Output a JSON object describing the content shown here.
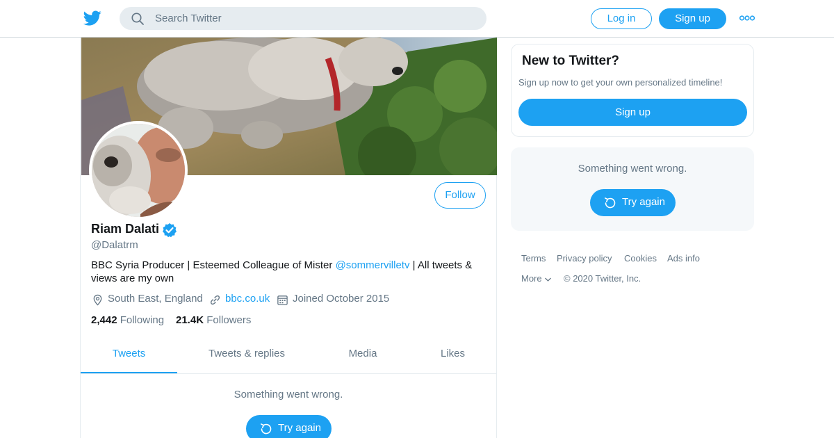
{
  "header": {
    "search_placeholder": "Search Twitter",
    "login_label": "Log in",
    "signup_label": "Sign up",
    "more_icon": "more-dots-icon",
    "logo_icon": "twitter-bird-icon"
  },
  "profile": {
    "name": "Riam Dalati",
    "handle": "@Dalatrm",
    "verified": true,
    "follow_label": "Follow",
    "bio_prefix": "BBC Syria Producer | Esteemed Colleague of Mister ",
    "bio_mention": "@sommervilletv",
    "bio_suffix": " | All tweets & views are my own",
    "location": "South East, England",
    "website": "bbc.co.uk",
    "joined": "Joined October 2015",
    "following_count": "2,442",
    "following_label": "Following",
    "followers_count": "21.4K",
    "followers_label": "Followers"
  },
  "tabs": [
    {
      "label": "Tweets",
      "active": true
    },
    {
      "label": "Tweets & replies",
      "active": false
    },
    {
      "label": "Media",
      "active": false
    },
    {
      "label": "Likes",
      "active": false
    }
  ],
  "timeline": {
    "error_text": "Something went wrong.",
    "try_again_label": "Try again"
  },
  "sidebar": {
    "new_title": "New to Twitter?",
    "new_sub": "Sign up now to get your own personalized timeline!",
    "signup_label": "Sign up",
    "error_text": "Something went wrong.",
    "try_again_label": "Try again"
  },
  "footer": {
    "links": [
      "Terms",
      "Privacy policy",
      "Cookies",
      "Ads info"
    ],
    "more_label": "More",
    "copyright": "© 2020 Twitter, Inc."
  },
  "colors": {
    "accent": "#1da1f2",
    "muted": "#657786",
    "border": "#e6ecf0"
  }
}
